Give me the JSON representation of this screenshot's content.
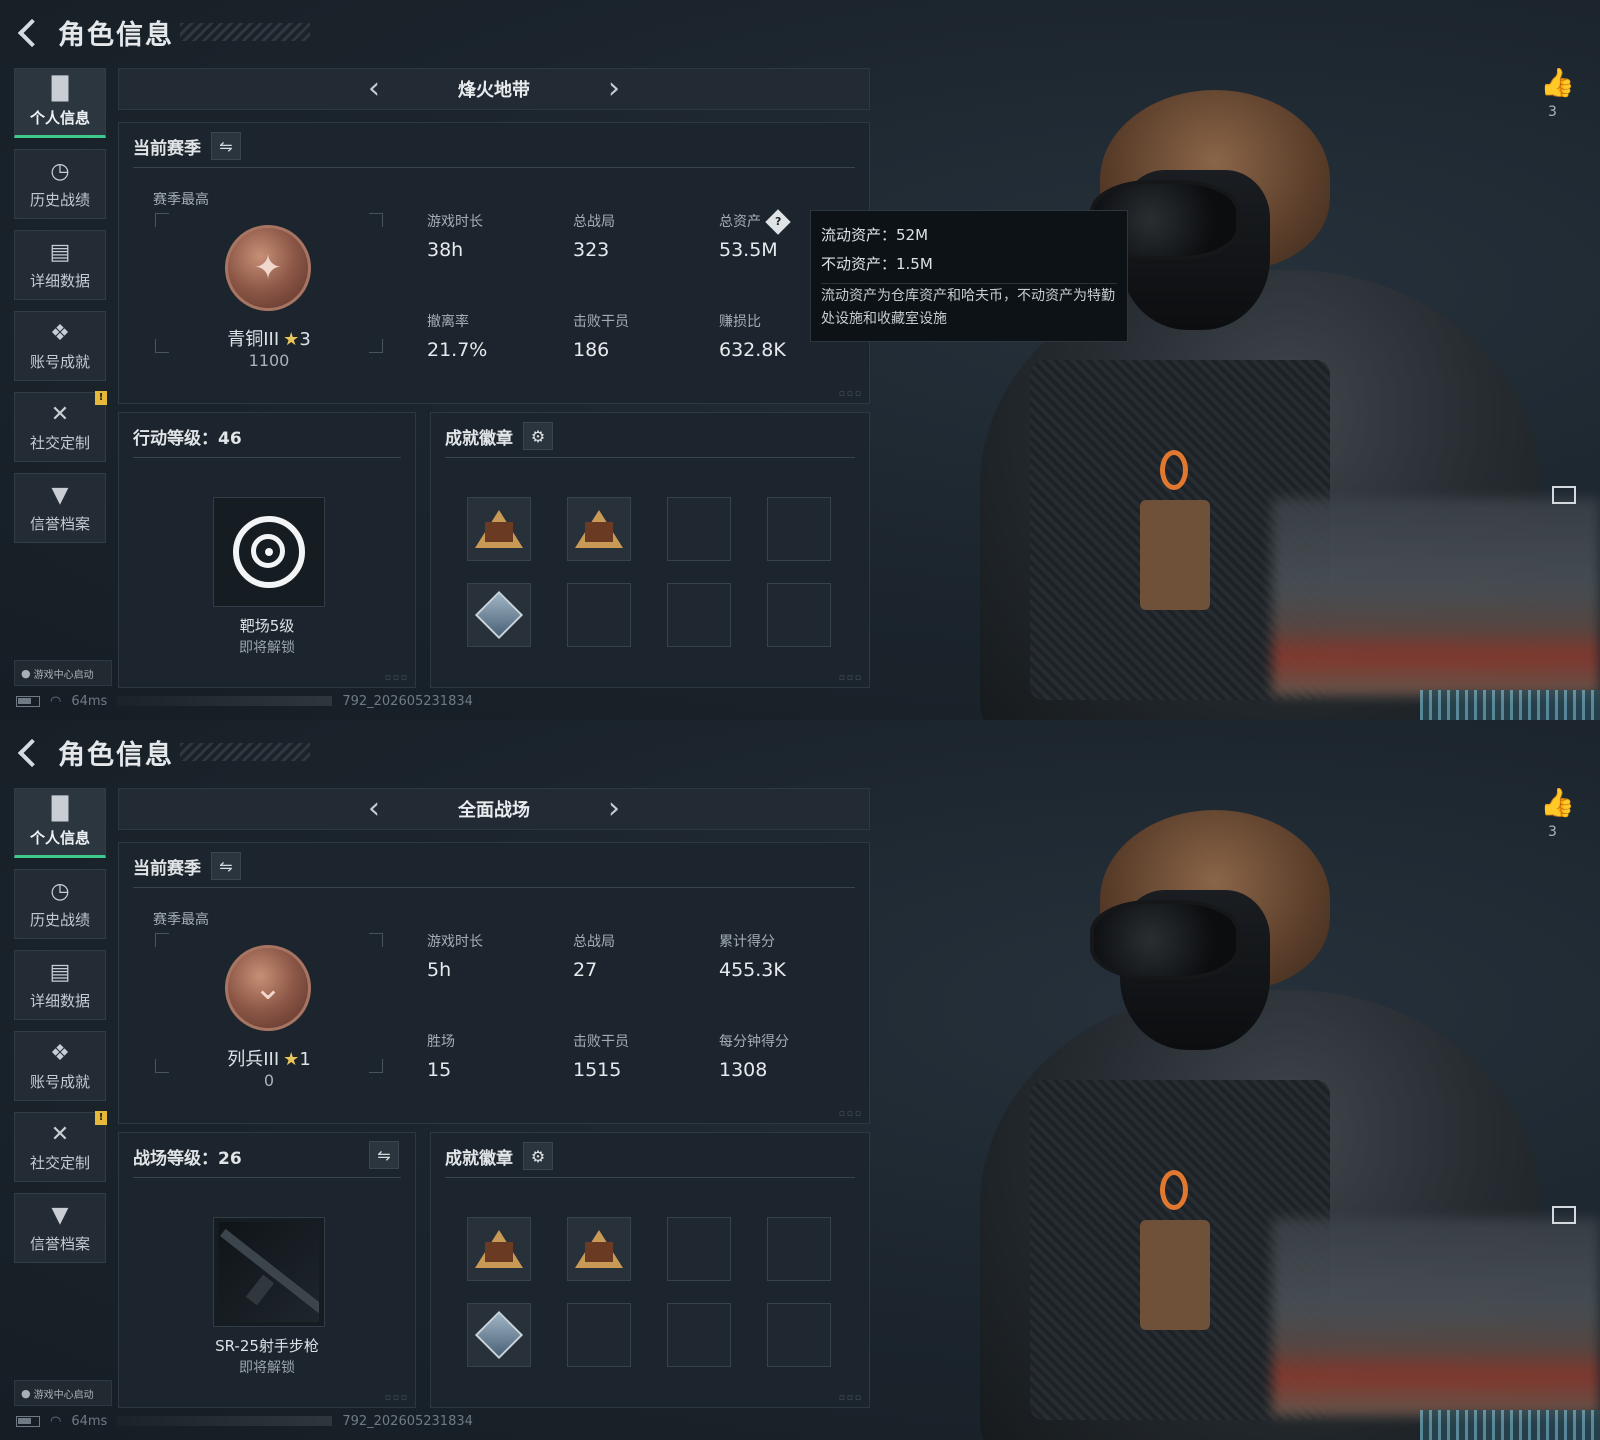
{
  "screens": [
    {
      "header_title": "角色信息",
      "sidebar": [
        {
          "label": "个人信息",
          "icon": "bar-chart-icon"
        },
        {
          "label": "历史战绩",
          "icon": "clock-icon"
        },
        {
          "label": "详细数据",
          "icon": "folder-icon"
        },
        {
          "label": "账号成就",
          "icon": "medal-icon"
        },
        {
          "label": "社交定制",
          "icon": "tools-icon",
          "alert": "!"
        },
        {
          "label": "信誉档案",
          "icon": "shield-icon"
        }
      ],
      "game_center_label": "游戏中心启动",
      "status": {
        "ping": "64ms",
        "build": "792_202605231834"
      },
      "mode_title": "烽火地带",
      "season": {
        "title": "当前赛季",
        "best_label": "赛季最高",
        "rank_name": "青铜III",
        "rank_stars": "3",
        "rank_points": "1100",
        "stats": [
          {
            "label": "游戏时长",
            "value": "38h"
          },
          {
            "label": "总战局",
            "value": "323"
          },
          {
            "label": "总资产",
            "value": "53.5M",
            "help": "?"
          },
          {
            "label": "撤离率",
            "value": "21.7%"
          },
          {
            "label": "击败干员",
            "value": "186"
          },
          {
            "label": "赚损比",
            "value": "632.8K"
          }
        ]
      },
      "level": {
        "title": "行动等级：46",
        "item_name": "靶场5级",
        "item_sub": "即将解锁",
        "item_icon": "target-icon"
      },
      "badges": {
        "title": "成就徽章"
      },
      "likes": "3",
      "tooltip": {
        "line1": "流动资产：52M",
        "line2": "不动资产：1.5M",
        "desc": "流动资产为仓库资产和哈夫币，不动资产为特勤处设施和收藏室设施"
      }
    },
    {
      "header_title": "角色信息",
      "sidebar": [
        {
          "label": "个人信息",
          "icon": "bar-chart-icon"
        },
        {
          "label": "历史战绩",
          "icon": "clock-icon"
        },
        {
          "label": "详细数据",
          "icon": "folder-icon"
        },
        {
          "label": "账号成就",
          "icon": "medal-icon"
        },
        {
          "label": "社交定制",
          "icon": "tools-icon",
          "alert": "!"
        },
        {
          "label": "信誉档案",
          "icon": "shield-icon"
        }
      ],
      "game_center_label": "游戏中心启动",
      "status": {
        "ping": "64ms",
        "build": "792_202605231834"
      },
      "mode_title": "全面战场",
      "season": {
        "title": "当前赛季",
        "best_label": "赛季最高",
        "rank_name": "列兵III",
        "rank_stars": "1",
        "rank_points": "0",
        "stats": [
          {
            "label": "游戏时长",
            "value": "5h"
          },
          {
            "label": "总战局",
            "value": "27"
          },
          {
            "label": "累计得分",
            "value": "455.3K"
          },
          {
            "label": "胜场",
            "value": "15"
          },
          {
            "label": "击败干员",
            "value": "1515"
          },
          {
            "label": "每分钟得分",
            "value": "1308"
          }
        ]
      },
      "level": {
        "title": "战场等级：26",
        "item_name": "SR-25射手步枪",
        "item_sub": "即将解锁",
        "item_icon": "rifle-icon"
      },
      "badges": {
        "title": "成就徽章"
      },
      "likes": "3"
    }
  ],
  "colors": {
    "accent_green": "#3fc98a",
    "alert_yellow": "#e6b93a",
    "panel_bg": "#1c252d"
  }
}
